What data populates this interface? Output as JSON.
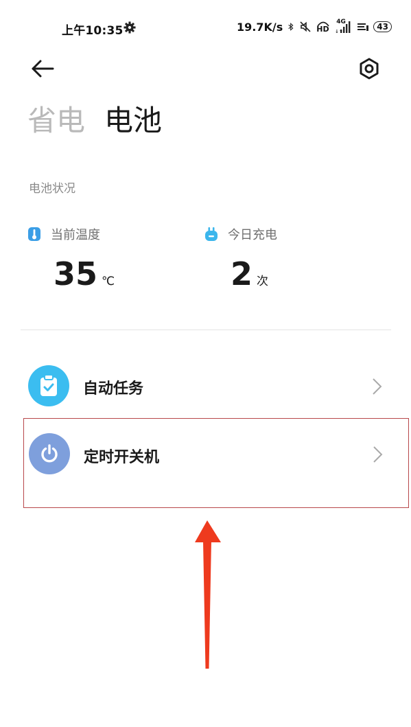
{
  "status_bar": {
    "time": "上午10:35",
    "network_speed": "19.7K/s",
    "signal_label": "4G",
    "hd_label": "HD",
    "battery": "43",
    "icons": [
      "gear-icon",
      "bluetooth-icon",
      "mute-icon",
      "hd-icon",
      "signal-icon",
      "wifi-icon",
      "battery-icon"
    ]
  },
  "app_bar": {
    "back_icon": "back-arrow-icon",
    "settings_icon": "settings-hex-icon"
  },
  "tabs": [
    {
      "label": "省电",
      "active": false
    },
    {
      "label": "电池",
      "active": true
    }
  ],
  "battery_status": {
    "section_label": "电池状况",
    "temperature": {
      "title": "当前温度",
      "value": "35",
      "unit": "℃",
      "icon": "thermometer-icon",
      "icon_color": "#3b9ee6"
    },
    "charges_today": {
      "title": "今日充电",
      "value": "2",
      "unit": "次",
      "icon": "plug-icon",
      "icon_color": "#3bb6ec"
    }
  },
  "list": [
    {
      "label": "自动任务",
      "icon": "clipboard-check-icon",
      "icon_bg": "#3bbdf0"
    },
    {
      "label": "定时开关机",
      "icon": "power-icon",
      "icon_bg": "#7e9fdc",
      "highlighted": true
    }
  ],
  "annotation": {
    "highlight_color": "#b7464a",
    "arrow_color": "#ee3a1e"
  }
}
